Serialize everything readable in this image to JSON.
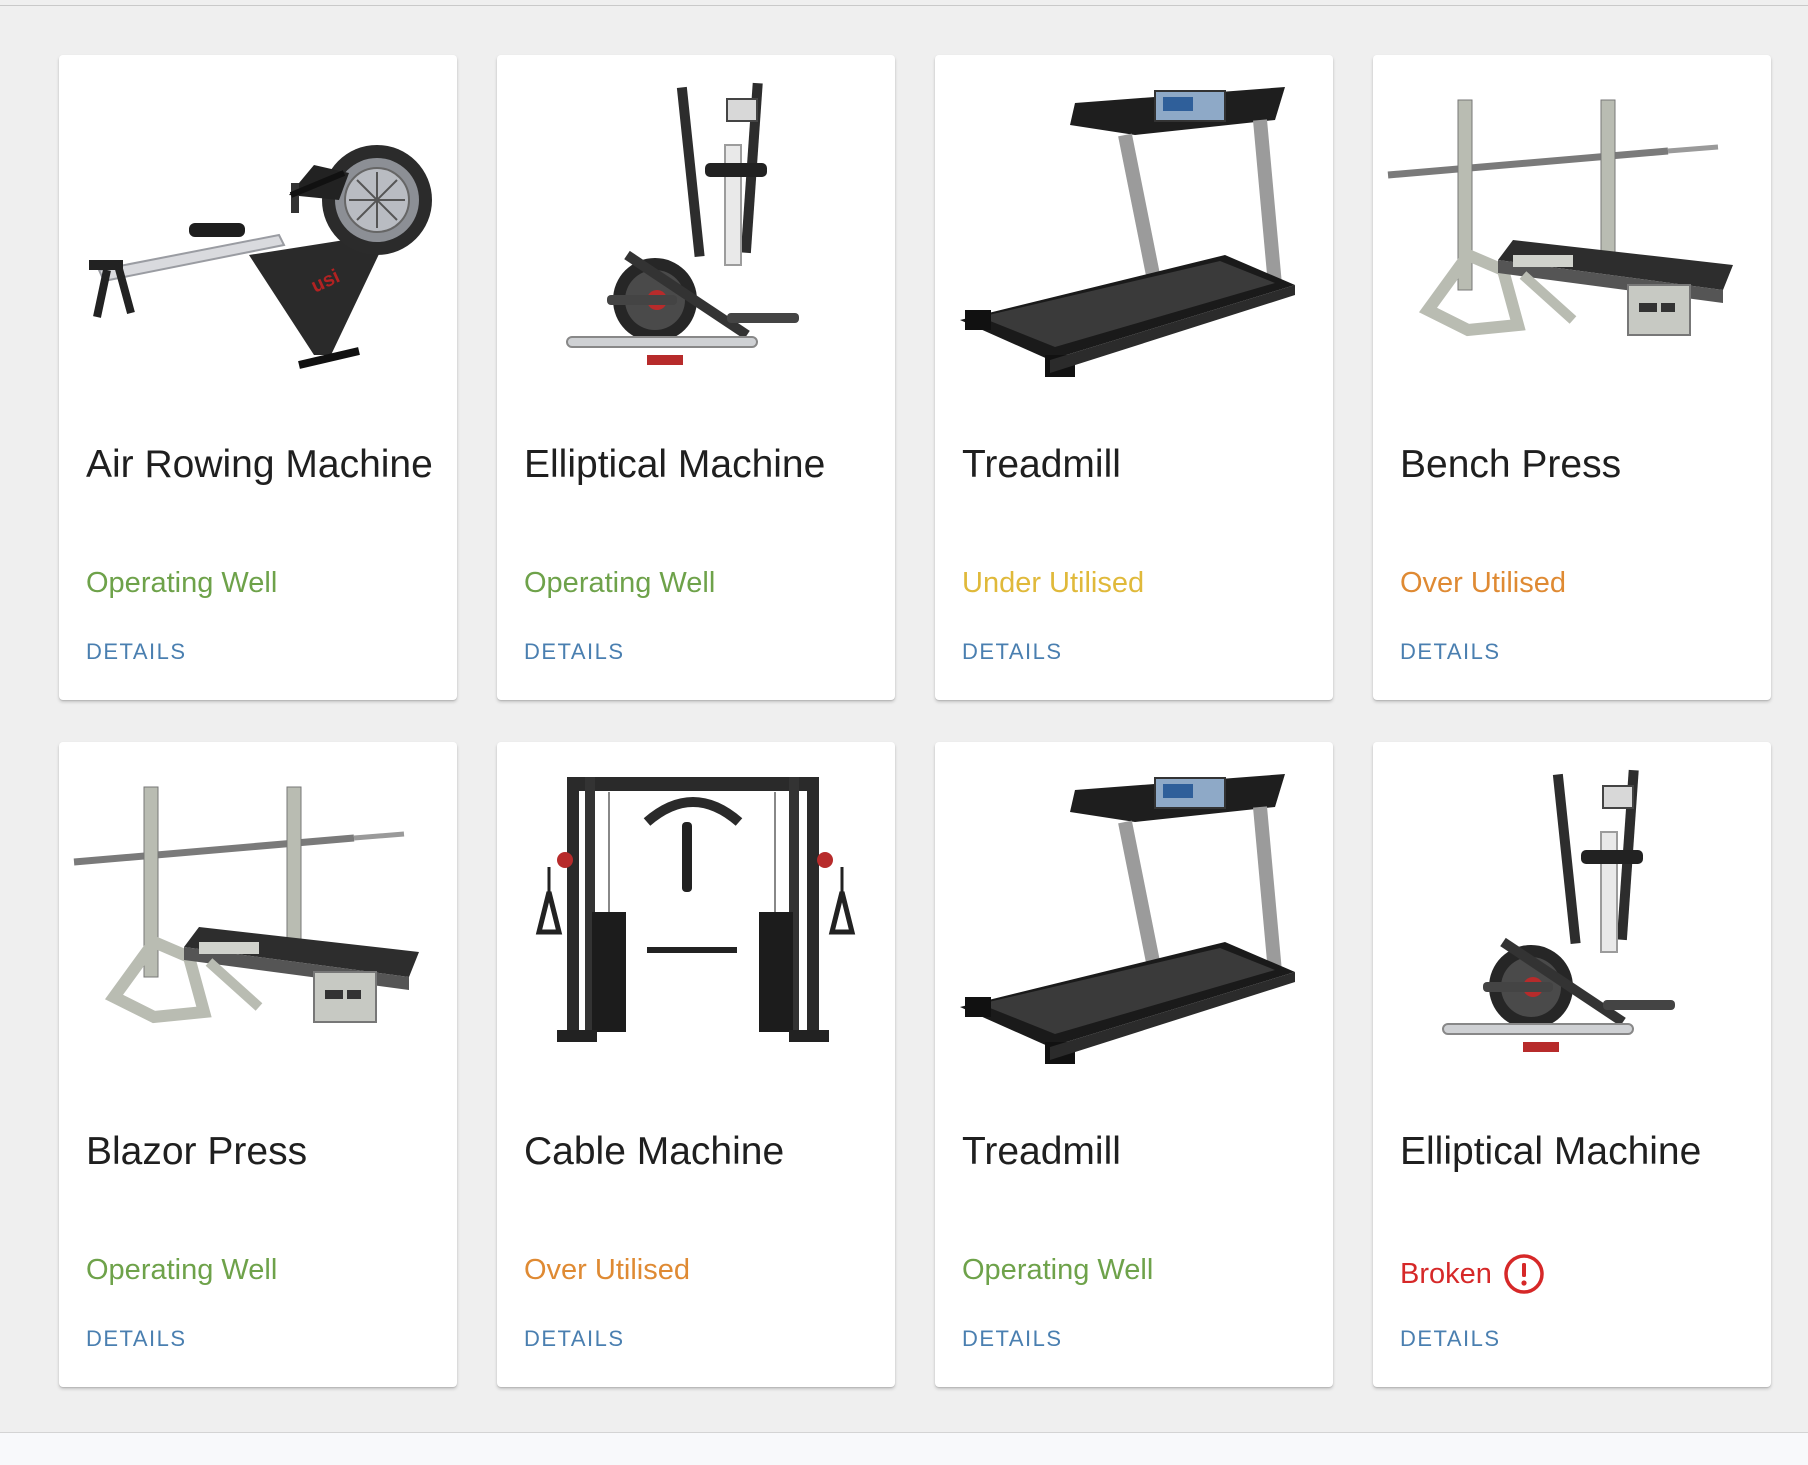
{
  "colors": {
    "operating_well": "#6ea24a",
    "under_utilised": "#e0b93a",
    "over_utilised": "#df8a33",
    "broken": "#d62828",
    "details_link": "#4a7fb0"
  },
  "cards": [
    {
      "title": "Air Rowing Machine",
      "status": "Operating Well",
      "status_key": "operating_well",
      "details_label": "DETAILS",
      "image": "rowing-machine"
    },
    {
      "title": "Elliptical Machine",
      "status": "Operating Well",
      "status_key": "operating_well",
      "details_label": "DETAILS",
      "image": "elliptical-machine"
    },
    {
      "title": "Treadmill",
      "status": "Under Utilised",
      "status_key": "under_utilised",
      "details_label": "DETAILS",
      "image": "treadmill"
    },
    {
      "title": "Bench Press",
      "status": "Over Utilised",
      "status_key": "over_utilised",
      "details_label": "DETAILS",
      "image": "bench-press"
    },
    {
      "title": "Blazor Press",
      "status": "Operating Well",
      "status_key": "operating_well",
      "details_label": "DETAILS",
      "image": "bench-press"
    },
    {
      "title": "Cable Machine",
      "status": "Over Utilised",
      "status_key": "over_utilised",
      "details_label": "DETAILS",
      "image": "cable-machine"
    },
    {
      "title": "Treadmill",
      "status": "Operating Well",
      "status_key": "operating_well",
      "details_label": "DETAILS",
      "image": "treadmill"
    },
    {
      "title": "Elliptical Machine",
      "status": "Broken",
      "status_key": "broken",
      "details_label": "DETAILS",
      "image": "elliptical-machine",
      "status_icon": "alert-circle-icon"
    }
  ]
}
